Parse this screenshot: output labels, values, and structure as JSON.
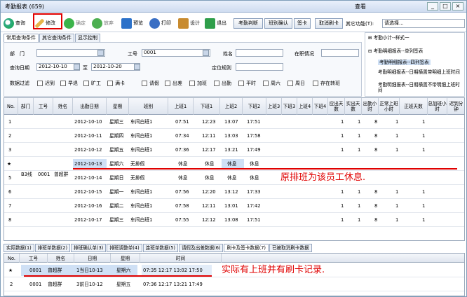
{
  "window": {
    "title": "考勤报表 (659)",
    "center": "查看",
    "min": "_",
    "max": "□",
    "close": "×"
  },
  "toolbar": {
    "query": "查询",
    "edit": "修改",
    "confirm": "确定",
    "abandon": "放弃",
    "preview": "预览",
    "print": "打印",
    "design": "设计",
    "exit": "退出",
    "judge": "考勤判断",
    "shift_confirm": "班别确认",
    "sign": "签卡",
    "cancel_swipe": "取消刷卡",
    "other_label": "其它功能(T):",
    "other_value": "请选择..."
  },
  "query_tabs": [
    "常用查询条件",
    "其它查询条件",
    "显示控制"
  ],
  "filter": {
    "dept_label": "部　门",
    "dept_value": "",
    "empno_label": "工号",
    "empno_value": "0001",
    "name_label": "姓名",
    "name_value": "",
    "status_label": "在职情况",
    "status_value": "",
    "date_label": "查询日期",
    "date_from": "2012-10-10",
    "to": "至",
    "date_to": "2012-10-20",
    "rule_label": "定位规则",
    "rule_value": "",
    "data_filter": "数据过滤",
    "checks": [
      "迟到",
      "早退",
      "旷工",
      "满卡",
      "请假",
      "出差",
      "加班",
      "出勤",
      "平时",
      "周六",
      "周日",
      "存在转班"
    ]
  },
  "tree": {
    "items": [
      "考勤小计--样式一",
      "考勤明细报表--单列签表",
      "考勤明细报表--四列签表",
      "考勤明细报表--日期横置带明细上班时间",
      "考勤明细报表--日期横置不带明细上班时间"
    ]
  },
  "grid": {
    "headers": [
      "No.",
      "部门",
      "工号",
      "姓名",
      "出勤日期",
      "星期",
      "班别",
      "上班1",
      "下班1",
      "上班2",
      "下班2",
      "上班3",
      "下班3",
      "上班4",
      "下班4",
      "应出天数",
      "实出天数",
      "出勤小时",
      "正常上班小时",
      "正班天数",
      "总加班小时",
      "迟到分钟"
    ],
    "dept": "B3线",
    "empno": "0001",
    "name": "曾超群",
    "star": "★",
    "rows": [
      {
        "no": "1",
        "date": "2012-10-10",
        "week": "星期三",
        "shift": "车间白班1",
        "in1": "07:51",
        "out1": "12:23",
        "in2": "13:07",
        "out2": "17:51",
        "due": "1",
        "act": "1",
        "hrs": "8",
        "normal": "1",
        "reg": "1"
      },
      {
        "no": "2",
        "date": "2012-10-11",
        "week": "星期四",
        "shift": "车间白班1",
        "in1": "07:34",
        "out1": "12:11",
        "in2": "13:03",
        "out2": "17:58",
        "due": "1",
        "act": "1",
        "hrs": "8",
        "normal": "1",
        "reg": "1"
      },
      {
        "no": "3",
        "date": "2012-10-12",
        "week": "星期五",
        "shift": "车间白班1",
        "in1": "07:36",
        "out1": "12:17",
        "in2": "13:21",
        "out2": "17:49",
        "due": "1",
        "act": "1",
        "hrs": "8",
        "normal": "1",
        "reg": "1"
      },
      {
        "no": "",
        "date": "2012-10-13",
        "week": "星期六",
        "shift": "无排假",
        "in1": "休息",
        "out1": "休息",
        "in2": "休息",
        "out2": "休息",
        "due": "",
        "act": "",
        "hrs": "",
        "normal": "",
        "reg": ""
      },
      {
        "no": "5",
        "date": "2012-10-14",
        "week": "星期日",
        "shift": "无排假",
        "in1": "休息",
        "out1": "休息",
        "in2": "休息",
        "out2": "休息",
        "due": "",
        "act": "",
        "hrs": "",
        "normal": "",
        "reg": ""
      },
      {
        "no": "6",
        "date": "2012-10-15",
        "week": "星期一",
        "shift": "车间白班1",
        "in1": "07:56",
        "out1": "12:20",
        "in2": "13:12",
        "out2": "17:33",
        "due": "1",
        "act": "1",
        "hrs": "8",
        "normal": "1",
        "reg": "1"
      },
      {
        "no": "7",
        "date": "2012-10-16",
        "week": "星期二",
        "shift": "车间白班1",
        "in1": "07:58",
        "out1": "12:11",
        "in2": "13:01",
        "out2": "17:42",
        "due": "1",
        "act": "1",
        "hrs": "8",
        "normal": "1",
        "reg": "1"
      },
      {
        "no": "8",
        "date": "2012-10-17",
        "week": "星期三",
        "shift": "车间白班1",
        "in1": "07:55",
        "out1": "12:12",
        "in2": "13:08",
        "out2": "17:51",
        "due": "1",
        "act": "1",
        "hrs": "8",
        "normal": "1",
        "reg": "1"
      }
    ],
    "annotation": "原排班为该员工休息."
  },
  "bottom_tabs": [
    "实际数据(1)",
    "排班单数据(2)",
    "排班确认单(3)",
    "排班调整单(4)",
    "连班单数据(5)",
    "请假及出差数据(6)",
    "刷卡及签卡数据(7)",
    "已被取消刷卡数据"
  ],
  "grid2": {
    "headers": [
      "No.",
      "工号",
      "姓名",
      "日期",
      "星期",
      "时间"
    ],
    "rows": [
      {
        "no": "★",
        "empno": "0001",
        "name": "曾超群",
        "date": "1当日10-13",
        "week": "星期六",
        "time": "07:35 12:17 13:02 17:50"
      },
      {
        "no": "2",
        "empno": "0001",
        "name": "曾超群",
        "date": "3前日10-12",
        "week": "星期五",
        "time": "07:36 12:17 13:21 17:49"
      }
    ],
    "annotation": "实际有上班并有刷卡记录."
  }
}
